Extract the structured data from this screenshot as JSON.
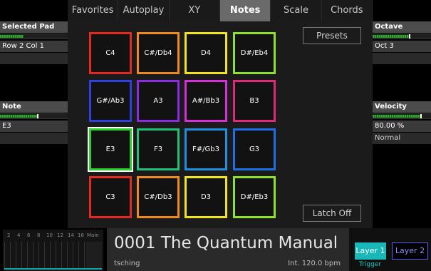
{
  "tabs": [
    "Favorites",
    "Autoplay",
    "XY",
    "Notes",
    "Scale",
    "Chords"
  ],
  "active_tab": "Notes",
  "left_panel": {
    "selected_pad_title": "Selected Pad",
    "selected_pad_value": "Row 2 Col 1",
    "note_title": "Note",
    "note_value": "E3",
    "selected_pad_level": 0.35,
    "note_level": 0.55
  },
  "right_panel": {
    "octave_title": "Octave",
    "octave_value": "Oct 3",
    "velocity_title": "Velocity",
    "velocity_value": "80.00 %",
    "velocity_mode": "Normal",
    "octave_level": 0.62,
    "velocity_level": 0.82
  },
  "buttons": {
    "presets": "Presets",
    "latch": "Latch Off"
  },
  "pads": [
    {
      "label": "C4",
      "color": "#e8271e"
    },
    {
      "label": "C#/Db4",
      "color": "#f08a1c"
    },
    {
      "label": "D4",
      "color": "#f2e41c"
    },
    {
      "label": "D#/Eb4",
      "color": "#8fe22a"
    },
    {
      "label": "G#/Ab3",
      "color": "#2f3fe0"
    },
    {
      "label": "A3",
      "color": "#8a2be2"
    },
    {
      "label": "A#/Bb3",
      "color": "#d62fd6"
    },
    {
      "label": "B3",
      "color": "#e0287a"
    },
    {
      "label": "E3",
      "color": "#2bd12b",
      "selected": true
    },
    {
      "label": "F3",
      "color": "#22c07a"
    },
    {
      "label": "F#/Gb3",
      "color": "#1f8fe0"
    },
    {
      "label": "G3",
      "color": "#1f6fe8"
    },
    {
      "label": "C3",
      "color": "#e8271e"
    },
    {
      "label": "C#/Db3",
      "color": "#f08a1c"
    },
    {
      "label": "D3",
      "color": "#f2e41c"
    },
    {
      "label": "D#/Eb3",
      "color": "#8fe22a"
    }
  ],
  "mixer": {
    "labels": [
      "2",
      "4",
      "6",
      "8",
      "10",
      "12",
      "14",
      "16",
      "Main"
    ]
  },
  "preset": {
    "name": "0001 The Quantum Manual",
    "author": "tsching",
    "tempo": "Int. 120.0 bpm"
  },
  "layers": {
    "layer1": "Layer 1",
    "layer2": "Layer 2",
    "mode": "Trigger"
  }
}
